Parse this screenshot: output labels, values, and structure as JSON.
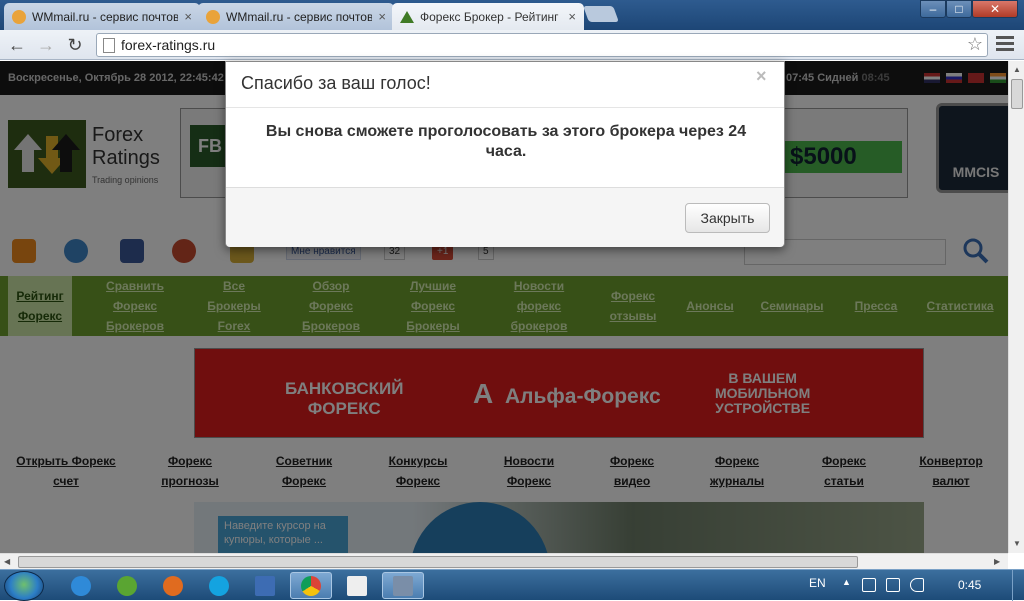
{
  "browser": {
    "tabs": [
      {
        "title": "WMmail.ru - сервис почтовых рассылок",
        "active": false
      },
      {
        "title": "WMmail.ru - сервис почтовых рассылок",
        "active": false
      },
      {
        "title": "Форекс Брокер - Рейтинг",
        "active": true
      }
    ],
    "tab_close": "×",
    "window_controls": {
      "minimize": "–",
      "maximize": "□",
      "close": "✕"
    },
    "nav": {
      "back": "←",
      "forward": "→",
      "reload": "↻"
    },
    "address": "forex-ratings.ru",
    "star": "☆"
  },
  "site": {
    "topbar_date": "Воскресенье, Октябрь 28 2012, 22:45:42",
    "topbar_right_time": "07:45",
    "topbar_right_city": "Сидней",
    "topbar_right_time2": "08:45",
    "logo": {
      "line1": "Forex",
      "line2": "Ratings",
      "sub": "Trading opinions"
    },
    "banner_top": {
      "left": "FB",
      "amount": "$5000"
    },
    "banner_mmcis": "MMCIS",
    "like_label": "Мне нравится",
    "like_count": "32",
    "gplus_label": "+1",
    "gplus_count": "5",
    "main_nav": [
      "Рейтинг Форекс",
      "Сравнить Форекс Брокеров",
      "Все Брокеры Forex",
      "Обзор Форекс Брокеров",
      "Лучшие Форекс Брокеры",
      "Новости форекс брокеров",
      "Форекс отзывы",
      "Анонсы",
      "Семинары",
      "Пресса",
      "Статистика"
    ],
    "banner_alfa": {
      "left_l1": "БАНКОВСКИЙ",
      "left_l2": "ФОРЕКС",
      "center_mark": "A",
      "center": "Альфа-Форекс",
      "right_l1": "В ВАШЕМ",
      "right_l2": "МОБИЛЬНОМ",
      "right_l3": "УСТРОЙСТВЕ"
    },
    "secondary_nav": [
      {
        "l1": "Открыть Форекс",
        "l2": "счет"
      },
      {
        "l1": "Форекс",
        "l2": "прогнозы"
      },
      {
        "l1": "Советник",
        "l2": "Форекс"
      },
      {
        "l1": "Конкурсы",
        "l2": "Форекс"
      },
      {
        "l1": "Новости",
        "l2": "Форекс"
      },
      {
        "l1": "Форекс",
        "l2": "видео"
      },
      {
        "l1": "Форекс",
        "l2": "журналы"
      },
      {
        "l1": "Форекс",
        "l2": "статьи"
      },
      {
        "l1": "Конвертор",
        "l2": "валют"
      }
    ],
    "banner_bottom_hint": "Наведите курсор на купюры, которые ..."
  },
  "modal": {
    "title": "Спасибо за ваш голос!",
    "close_x": "×",
    "body": "Вы снова сможете проголосовать за этого брокера через 24 часа.",
    "close_button": "Закрыть"
  },
  "taskbar": {
    "lang": "EN",
    "tray_up": "▲",
    "clock": "0:45"
  }
}
